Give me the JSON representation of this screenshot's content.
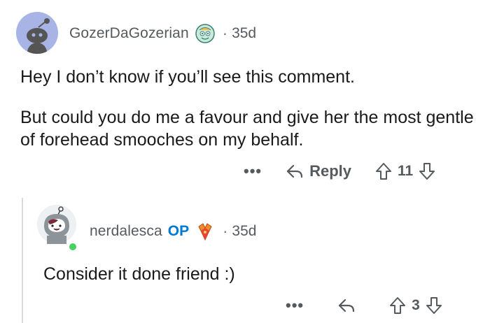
{
  "parent_comment": {
    "username": "GozerDaGozerian",
    "separator": "·",
    "age": "35d",
    "paragraphs": [
      "Hey I don’t know if you’ll see this comment.",
      "But could you do me a favour and give her the most gentle of forehead smooches on my behalf."
    ],
    "actions": {
      "more": "•••",
      "reply_label": "Reply",
      "score": "11"
    }
  },
  "reply_comment": {
    "username": "nerdalesca",
    "op_badge": "OP",
    "separator": "·",
    "age": "35d",
    "text": "Consider it done friend :)",
    "actions": {
      "more": "•••",
      "score": "3"
    }
  },
  "colors": {
    "text_primary": "#1a1a1b",
    "text_meta": "#555a5e",
    "op_blue": "#0079d3",
    "online_green": "#46d160",
    "thread_line": "#d9dadc",
    "avatar_bg": "#a8b4e6"
  },
  "icons": {
    "reply": "reply-arrow-icon",
    "upvote": "upvote-arrow-icon",
    "downvote": "downvote-arrow-icon",
    "flair_parent": "snoo-flair-icon",
    "flair_reply": "award-flair-icon"
  }
}
